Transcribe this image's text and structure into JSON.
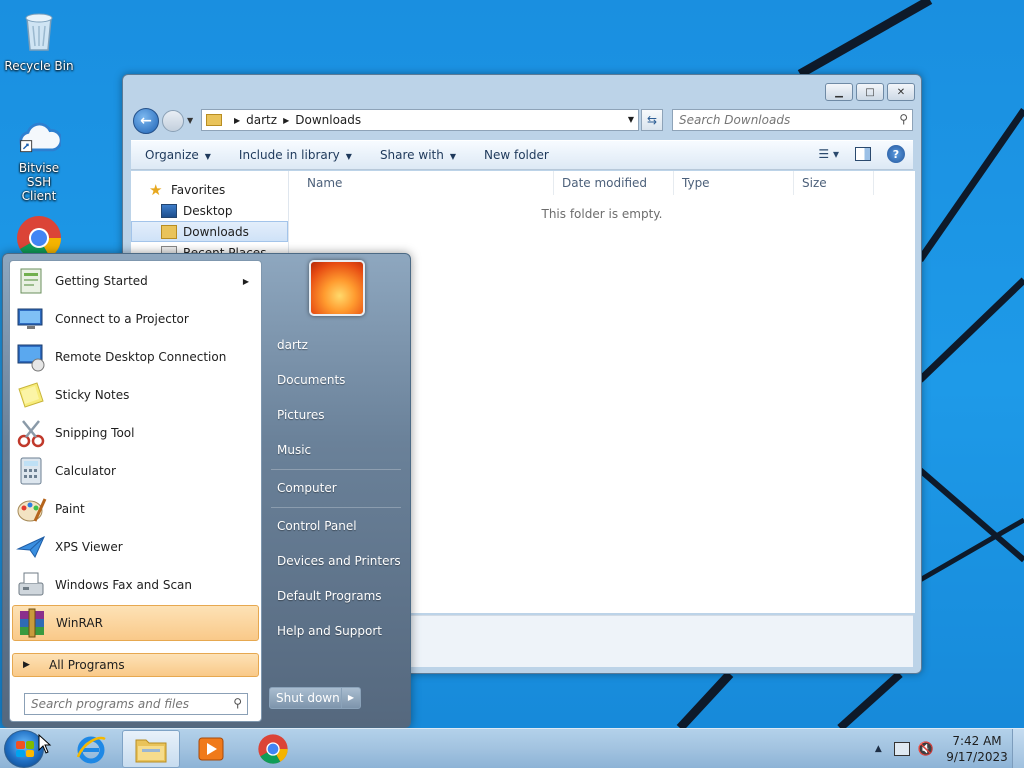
{
  "desktop": {
    "icons": [
      {
        "label": "Recycle Bin",
        "icon": "recycle-bin-icon"
      },
      {
        "label": "Bitvise SSH Client",
        "icon": "bitvise-icon"
      },
      {
        "label": "Google Chrome",
        "icon": "chrome-icon"
      }
    ]
  },
  "explorer": {
    "address": {
      "segments": [
        "dartz",
        "Downloads"
      ]
    },
    "search_placeholder": "Search Downloads",
    "commands": {
      "organize": "Organize",
      "include_in_library": "Include in library",
      "share_with": "Share with",
      "new_folder": "New folder"
    },
    "nav": {
      "favorites": "Favorites",
      "desktop": "Desktop",
      "downloads": "Downloads",
      "recent_places": "Recent Places"
    },
    "columns": [
      "Name",
      "Date modified",
      "Type",
      "Size"
    ],
    "empty_message": "This folder is empty."
  },
  "start_menu": {
    "programs": [
      {
        "label": "Getting Started",
        "icon": "getting-started-icon",
        "submenu": true
      },
      {
        "label": "Connect to a Projector",
        "icon": "projector-icon"
      },
      {
        "label": "Remote Desktop Connection",
        "icon": "remote-desktop-icon"
      },
      {
        "label": "Sticky Notes",
        "icon": "sticky-notes-icon"
      },
      {
        "label": "Snipping Tool",
        "icon": "snipping-tool-icon"
      },
      {
        "label": "Calculator",
        "icon": "calculator-icon"
      },
      {
        "label": "Paint",
        "icon": "paint-icon"
      },
      {
        "label": "XPS Viewer",
        "icon": "xps-viewer-icon"
      },
      {
        "label": "Windows Fax and Scan",
        "icon": "fax-scan-icon"
      },
      {
        "label": "WinRAR",
        "icon": "winrar-icon",
        "highlighted": true
      }
    ],
    "all_programs": "All Programs",
    "search_placeholder": "Search programs and files",
    "right": {
      "user": "dartz",
      "documents": "Documents",
      "pictures": "Pictures",
      "music": "Music",
      "computer": "Computer",
      "control_panel": "Control Panel",
      "devices_printers": "Devices and Printers",
      "default_programs": "Default Programs",
      "help_support": "Help and Support"
    },
    "shutdown": "Shut down"
  },
  "taskbar": {
    "pinned": [
      "ie-icon",
      "explorer-folder-icon",
      "media-player-icon",
      "chrome-icon"
    ],
    "clock": {
      "time": "7:42 AM",
      "date": "9/17/2023"
    }
  },
  "colors": {
    "highlight": "#f9c989",
    "taskbar": "#a2c3e0",
    "wallpaper": "#1e9ae8"
  }
}
